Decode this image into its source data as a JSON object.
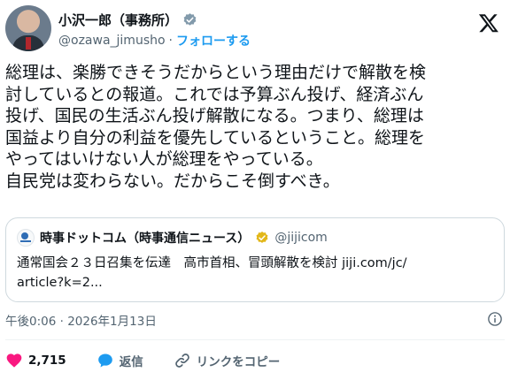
{
  "author": {
    "display_name": "小沢一郎（事務所）",
    "handle": "@ozawa_jimusho",
    "separator": "·",
    "follow_label": "フォローする"
  },
  "tweet_lines": [
    "総理は、楽勝できそうだからという理由だけで解散を検",
    "討しているとの報道。これでは予算ぶん投げ、経済ぶん",
    "投げ、国民の生活ぶん投げ解散になる。つまり、総理は",
    "国益より自分の利益を優先しているということ。総理を",
    "やってはいけない人が総理をやっている。",
    "自民党は変わらない。だからこそ倒すべき。"
  ],
  "quote": {
    "name": "時事ドットコム（時事通信ニュース）",
    "handle": "@jijicom",
    "lines": [
      "通常国会２３日召集を伝達　高市首相、冒頭解散を検討 jiji.com/jc/",
      "article?k=2..."
    ]
  },
  "timestamp": "午後0:06 · 2026年1月13日",
  "actions": {
    "like_count": "2,715",
    "reply_label": "返信",
    "copy_link_label": "リンクをコピー"
  },
  "colors": {
    "accent": "#1d9bf0",
    "like": "#f91880",
    "gold_badge": "#e2b719",
    "text": "#0f1419",
    "muted": "#536471"
  }
}
